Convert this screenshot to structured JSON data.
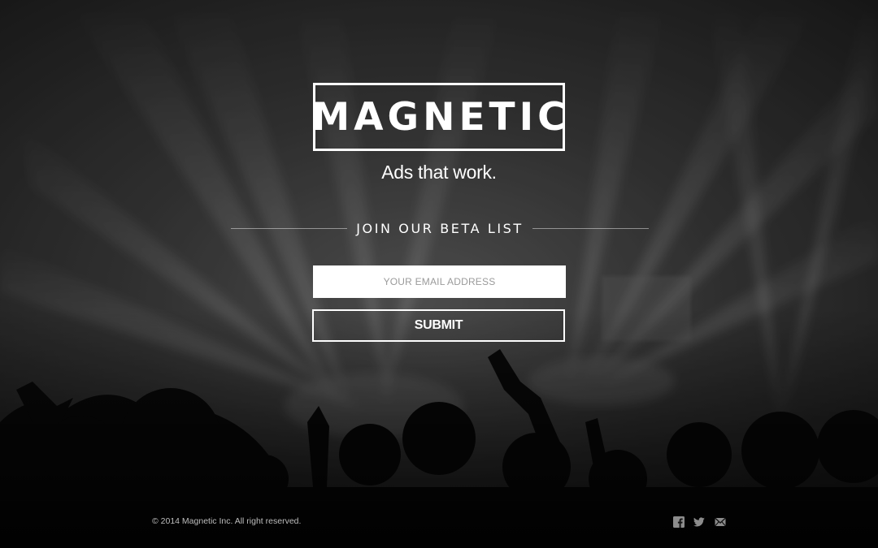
{
  "brand": {
    "logo": "MAGNETIC",
    "tagline": "Ads that work."
  },
  "signup": {
    "heading": "JOIN OUR BETA LIST",
    "email_placeholder": "YOUR EMAIL ADDRESS",
    "email_value": "",
    "submit_label": "SUBMIT"
  },
  "footer": {
    "copyright": "© 2014 Magnetic Inc. All right reserved.",
    "social_icons": [
      "facebook-icon",
      "twitter-icon",
      "mail-icon"
    ]
  },
  "colors": {
    "text": "#ffffff",
    "input_background": "#ffffff",
    "placeholder": "#9a9a9a",
    "footer_text": "#bdbdbd",
    "icons": "#8c8c8c"
  }
}
